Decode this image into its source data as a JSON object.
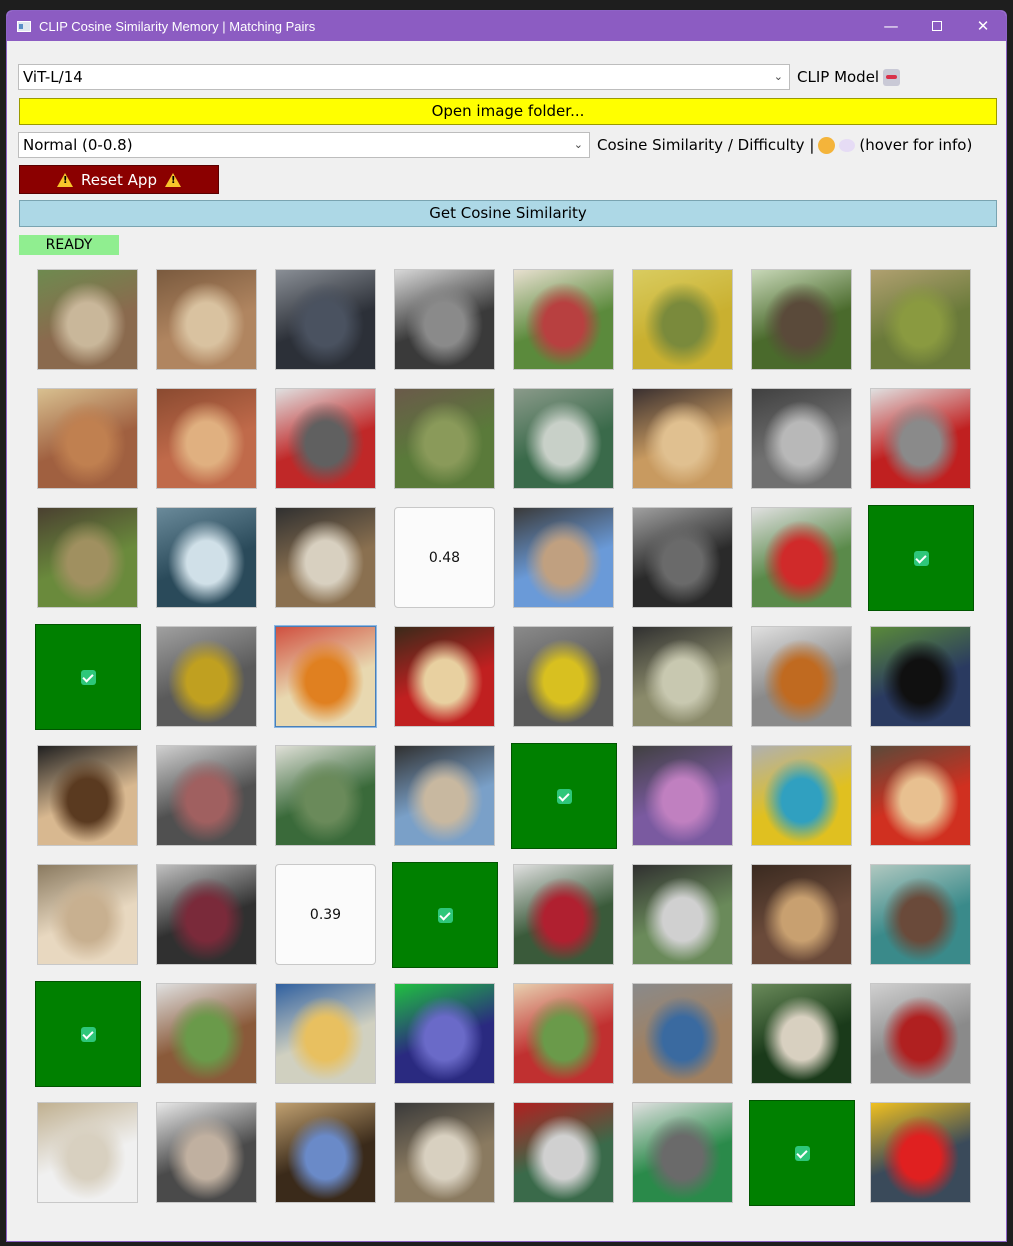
{
  "window": {
    "title": "CLIP Cosine Similarity Memory | Matching Pairs",
    "minimize": "—",
    "close": "✕"
  },
  "controls": {
    "model_select_value": "ViT-L/14",
    "model_label": "CLIP Model",
    "open_folder_label": "Open image folder...",
    "difficulty_select_value": "Normal (0-0.8)",
    "difficulty_label": "Cosine Similarity / Difficulty |",
    "difficulty_hint": "(hover for info)",
    "reset_label": "Reset App",
    "get_cosine_label": "Get Cosine Similarity",
    "status_text": "READY"
  },
  "icons": {
    "app": "app-window-icon",
    "model": "robot-emoji-icon",
    "difficulty": "thinking-face-emoji-icon",
    "bubble": "thought-bubble-emoji-icon",
    "warning": "warning-icon",
    "matched": "checkmark-icon"
  },
  "colors": {
    "titlebar": "#8c5cc2",
    "open_button": "#ffff00",
    "reset_button": "#8b0000",
    "cosine_button": "#add8e6",
    "status": "#90ee90",
    "matched_tile": "#008000"
  },
  "board": {
    "rows": [
      [
        {
          "s": "photo",
          "d": "horses"
        },
        {
          "s": "photo",
          "d": "brown bear"
        },
        {
          "s": "photo",
          "d": "boat"
        },
        {
          "s": "photo",
          "d": "black bear on bench"
        },
        {
          "s": "photo",
          "d": "plant with ornaments"
        },
        {
          "s": "photo",
          "d": "yellow bird"
        },
        {
          "s": "photo",
          "d": "bird on branch"
        },
        {
          "s": "photo",
          "d": "broccoli"
        }
      ],
      [
        {
          "s": "photo",
          "d": "tennis racket"
        },
        {
          "s": "photo",
          "d": "apple"
        },
        {
          "s": "photo",
          "d": "red vehicles"
        },
        {
          "s": "photo",
          "d": "bear on grass"
        },
        {
          "s": "photo",
          "d": "flower bowl"
        },
        {
          "s": "photo",
          "d": "lion and zebra"
        },
        {
          "s": "photo",
          "d": "sink"
        },
        {
          "s": "photo",
          "d": "fire truck"
        }
      ],
      [
        {
          "s": "photo",
          "d": "dog running"
        },
        {
          "s": "photo",
          "d": "water skiing"
        },
        {
          "s": "photo",
          "d": "bird and zebra"
        },
        {
          "s": "revealed",
          "v": "0.48"
        },
        {
          "s": "photo",
          "d": "birds on branch"
        },
        {
          "s": "photo",
          "d": "bicycles"
        },
        {
          "s": "photo",
          "d": "fire hydrant"
        },
        {
          "s": "matched"
        }
      ],
      [
        {
          "s": "matched"
        },
        {
          "s": "photo",
          "d": "train"
        },
        {
          "s": "photo",
          "d": "cake",
          "sel": true
        },
        {
          "s": "photo",
          "d": "bitten apple"
        },
        {
          "s": "photo",
          "d": "yellow bicycle"
        },
        {
          "s": "photo",
          "d": "zebras"
        },
        {
          "s": "photo",
          "d": "robin"
        },
        {
          "s": "photo",
          "d": "black bear"
        }
      ],
      [
        {
          "s": "photo",
          "d": "pizza hand"
        },
        {
          "s": "photo",
          "d": "red chair laptop"
        },
        {
          "s": "photo",
          "d": "park bench"
        },
        {
          "s": "photo",
          "d": "beach"
        },
        {
          "s": "matched"
        },
        {
          "s": "photo",
          "d": "purple flowers"
        },
        {
          "s": "photo",
          "d": "yellow train"
        },
        {
          "s": "photo",
          "d": "pizza person"
        }
      ],
      [
        {
          "s": "photo",
          "d": "toilet"
        },
        {
          "s": "photo",
          "d": "scooter"
        },
        {
          "s": "revealed",
          "v": "0.39"
        },
        {
          "s": "matched"
        },
        {
          "s": "photo",
          "d": "flag hydrant"
        },
        {
          "s": "photo",
          "d": "baseball player"
        },
        {
          "s": "photo",
          "d": "cat on floor"
        },
        {
          "s": "photo",
          "d": "green chair"
        }
      ],
      [
        {
          "s": "matched"
        },
        {
          "s": "photo",
          "d": "cows"
        },
        {
          "s": "photo",
          "d": "plate food"
        },
        {
          "s": "photo",
          "d": "traffic light"
        },
        {
          "s": "photo",
          "d": "dog on blanket"
        },
        {
          "s": "photo",
          "d": "clock"
        },
        {
          "s": "photo",
          "d": "baseball hand"
        },
        {
          "s": "photo",
          "d": "motorcycle"
        }
      ],
      [
        {
          "s": "photo",
          "d": "egret"
        },
        {
          "s": "photo",
          "d": "dog face"
        },
        {
          "s": "photo",
          "d": "laptop"
        },
        {
          "s": "photo",
          "d": "wall clock"
        },
        {
          "s": "photo",
          "d": "batter"
        },
        {
          "s": "photo",
          "d": "parking sign"
        },
        {
          "s": "matched"
        },
        {
          "s": "photo",
          "d": "traffic signal"
        }
      ]
    ],
    "revealed_labels": [
      "0.48",
      "0.39"
    ]
  }
}
